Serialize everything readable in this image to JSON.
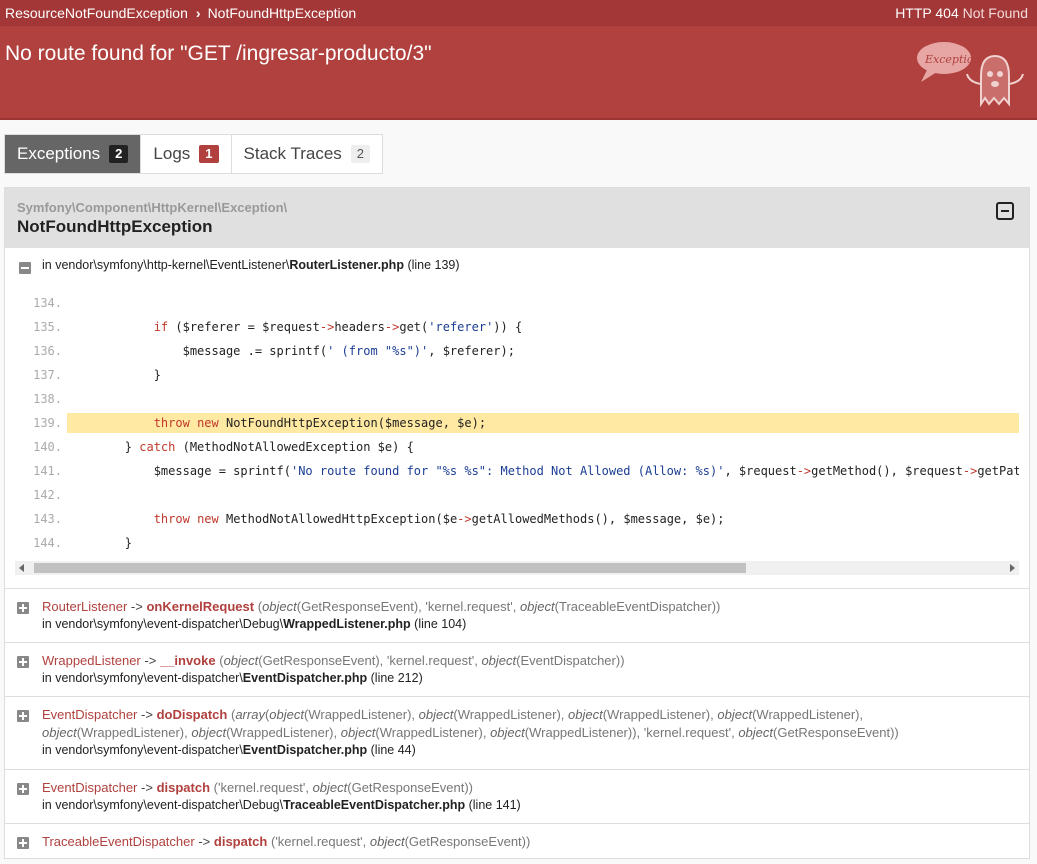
{
  "topbar": {
    "crumb1": "ResourceNotFoundException",
    "crumb2": "NotFoundHttpException",
    "http_label": "HTTP 404",
    "http_status": "Not Found"
  },
  "header": {
    "title": "No route found for \"GET /ingresar-producto/3\"",
    "logo_text": "Exception!"
  },
  "tabs": [
    {
      "label": "Exceptions",
      "count": "2"
    },
    {
      "label": "Logs",
      "count": "1"
    },
    {
      "label": "Stack Traces",
      "count": "2"
    }
  ],
  "exception": {
    "namespace": "Symfony\\Component\\HttpKernel\\Exception\\",
    "name": "NotFoundHttpException",
    "file_prefix": "in vendor\\symfony\\http-kernel\\EventListener\\",
    "file_name": "RouterListener.php",
    "file_line": "(line 139)"
  },
  "code_lines": [
    {
      "n": "134.",
      "text": ""
    },
    {
      "n": "135.",
      "text": "            if ($referer = $request->headers->get('referer')) {"
    },
    {
      "n": "136.",
      "text": "                $message .= sprintf(' (from \"%s\")', $referer);"
    },
    {
      "n": "137.",
      "text": "            }"
    },
    {
      "n": "138.",
      "text": ""
    },
    {
      "n": "139.",
      "text": "            throw new NotFoundHttpException($message, $e);"
    },
    {
      "n": "140.",
      "text": "        } catch (MethodNotAllowedException $e) {"
    },
    {
      "n": "141.",
      "text": "            $message = sprintf('No route found for \"%s %s\": Method Not Allowed (Allow: %s)', $request->getMethod(), $request->getPat"
    },
    {
      "n": "142.",
      "text": ""
    },
    {
      "n": "143.",
      "text": "            throw new MethodNotAllowedHttpException($e->getAllowedMethods(), $message, $e);"
    },
    {
      "n": "144.",
      "text": "        }"
    }
  ],
  "traces": [
    {
      "cls": "RouterListener",
      "arrow": "->",
      "method": "onKernelRequest",
      "args": "(object(GetResponseEvent), 'kernel.request', object(TraceableEventDispatcher))",
      "file_prefix": "in vendor\\symfony\\event-dispatcher\\Debug\\",
      "file_name": "WrappedListener.php",
      "file_line": "(line 104)"
    },
    {
      "cls": "WrappedListener",
      "arrow": "->",
      "method": "__invoke",
      "args": "(object(GetResponseEvent), 'kernel.request', object(EventDispatcher))",
      "file_prefix": "in vendor\\symfony\\event-dispatcher\\",
      "file_name": "EventDispatcher.php",
      "file_line": "(line 212)"
    },
    {
      "cls": "EventDispatcher",
      "arrow": "->",
      "method": "doDispatch",
      "args": "(array(object(WrappedListener), object(WrappedListener), object(WrappedListener), object(WrappedListener), object(WrappedListener), object(WrappedListener), object(WrappedListener), object(WrappedListener)), 'kernel.request', object(GetResponseEvent))",
      "file_prefix": "in vendor\\symfony\\event-dispatcher\\",
      "file_name": "EventDispatcher.php",
      "file_line": "(line 44)"
    },
    {
      "cls": "EventDispatcher",
      "arrow": "->",
      "method": "dispatch",
      "args": "('kernel.request', object(GetResponseEvent))",
      "file_prefix": "in vendor\\symfony\\event-dispatcher\\Debug\\",
      "file_name": "TraceableEventDispatcher.php",
      "file_line": "(line 141)"
    },
    {
      "cls": "TraceableEventDispatcher",
      "arrow": "->",
      "method": "dispatch",
      "args": "('kernel.request', object(GetResponseEvent))",
      "file_prefix": "",
      "file_name": "",
      "file_line": ""
    }
  ]
}
